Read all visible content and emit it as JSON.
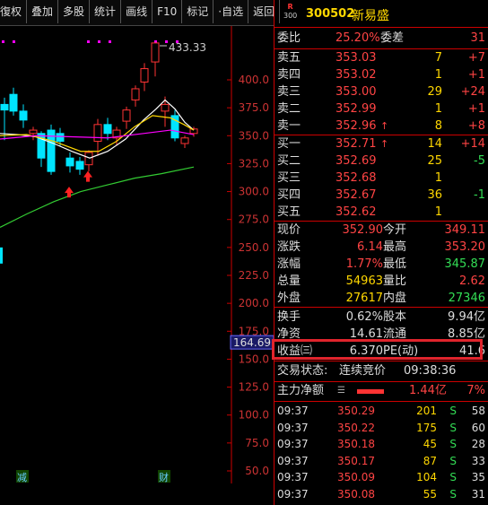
{
  "toolbar": {
    "buttons": [
      "復权",
      "叠加",
      "多股",
      "统计",
      "画线",
      "F10",
      "标记",
      "·自选",
      "返回"
    ]
  },
  "chart": {
    "max_label": "433.33",
    "y_ticks": [
      "400.0",
      "375.0",
      "350.0",
      "325.0",
      "300.0",
      "275.0",
      "250.0",
      "225.0",
      "200.0",
      "175.0",
      "150.0",
      "125.0",
      "100.0",
      "75.0",
      "50.0"
    ],
    "price_tag": "164.69",
    "bottom_labels": [
      "减",
      "财"
    ],
    "colors": {
      "up": "#ff3333",
      "down": "#00e5ff",
      "ma_white": "#ffffff",
      "ma_yellow": "#ffd700",
      "ma_magenta": "#ff00ff",
      "ma_green": "#33cc33"
    }
  },
  "header": {
    "badge_r": "R",
    "badge_num": "300",
    "code": "300502",
    "name": "新易盛"
  },
  "weibi": {
    "label": "委比",
    "value": "25.20%",
    "label2": "委差",
    "value2": "31"
  },
  "sells": [
    {
      "label": "卖五",
      "price": "353.03",
      "vol": "7",
      "chg": "+7"
    },
    {
      "label": "卖四",
      "price": "353.02",
      "vol": "1",
      "chg": "+1"
    },
    {
      "label": "卖三",
      "price": "353.00",
      "vol": "29",
      "chg": "+24"
    },
    {
      "label": "卖二",
      "price": "352.99",
      "vol": "1",
      "chg": "+1"
    },
    {
      "label": "卖一",
      "price": "352.96",
      "arrow": "↑",
      "vol": "8",
      "chg": "+8"
    }
  ],
  "buys": [
    {
      "label": "买一",
      "price": "352.71",
      "arrow": "↑",
      "vol": "14",
      "chg": "+14"
    },
    {
      "label": "买二",
      "price": "352.69",
      "vol": "25",
      "chg": "-5"
    },
    {
      "label": "买三",
      "price": "352.68",
      "vol": "1",
      "chg": ""
    },
    {
      "label": "买四",
      "price": "352.67",
      "vol": "36",
      "chg": "-1"
    },
    {
      "label": "买五",
      "price": "352.62",
      "vol": "1",
      "chg": ""
    }
  ],
  "quote": [
    {
      "l1": "现价",
      "v1": "352.90",
      "l2": "今开",
      "v2": "349.11"
    },
    {
      "l1": "涨跌",
      "v1": "6.14",
      "l2": "最高",
      "v2": "353.20"
    },
    {
      "l1": "涨幅",
      "v1": "1.77%",
      "l2": "最低",
      "v2": "345.87"
    },
    {
      "l1": "总量",
      "v1": "54963",
      "l2": "量比",
      "v2": "2.62"
    },
    {
      "l1": "外盘",
      "v1": "27617",
      "l2": "内盘",
      "v2": "27346"
    }
  ],
  "fund": [
    {
      "l1": "换手",
      "v1": "0.62%",
      "l2": "股本",
      "v2": "9.94亿"
    },
    {
      "l1": "净资",
      "v1": "14.61",
      "l2": "流通",
      "v2": "8.85亿"
    },
    {
      "l1": "收益㈢",
      "v1": "6.370",
      "l2": "PE(动)",
      "v2": "41.6"
    }
  ],
  "status": {
    "label": "交易状态:",
    "value": "连续竞价",
    "time": "09:38:36"
  },
  "mainflow": {
    "label": "主力净额",
    "value": "1.44亿",
    "pct": "7%"
  },
  "ticks": [
    {
      "t": "09:37",
      "p": "350.29",
      "v": "201",
      "s": "S",
      "n": "58"
    },
    {
      "t": "09:37",
      "p": "350.22",
      "v": "175",
      "s": "S",
      "n": "60"
    },
    {
      "t": "09:37",
      "p": "350.18",
      "v": "45",
      "s": "S",
      "n": "28"
    },
    {
      "t": "09:37",
      "p": "350.17",
      "v": "87",
      "s": "S",
      "n": "33"
    },
    {
      "t": "09:37",
      "p": "350.09",
      "v": "104",
      "s": "S",
      "n": "35"
    },
    {
      "t": "09:37",
      "p": "350.08",
      "v": "55",
      "s": "S",
      "n": "31"
    }
  ]
}
